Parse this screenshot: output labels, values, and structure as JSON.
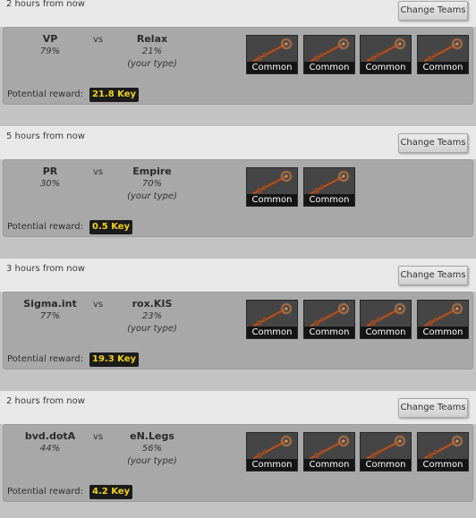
{
  "change_teams_label": "Change Teams",
  "potential_reward_label": "Potential reward:",
  "vs_label": "vs",
  "your_type_label": "(your type)",
  "item_icon": "key-icon",
  "colors": {
    "reward_text": "#f2d21a",
    "header_bg": "#e8e8e8",
    "body_bg": "#a8a8a8"
  },
  "matches": [
    {
      "time": "2 hours from now",
      "team_a": {
        "name": "VP",
        "pct": "79%"
      },
      "team_b": {
        "name": "Relax",
        "pct": "21%"
      },
      "items": [
        "Common",
        "Common",
        "Common",
        "Common"
      ],
      "reward": "21.8 Key"
    },
    {
      "time": "5 hours from now",
      "team_a": {
        "name": "PR",
        "pct": "30%"
      },
      "team_b": {
        "name": "Empire",
        "pct": "70%"
      },
      "items": [
        "Common",
        "Common"
      ],
      "reward": "0.5 Key"
    },
    {
      "time": "3 hours from now",
      "team_a": {
        "name": "Sigma.int",
        "pct": "77%"
      },
      "team_b": {
        "name": "rox.KIS",
        "pct": "23%"
      },
      "items": [
        "Common",
        "Common",
        "Common",
        "Common"
      ],
      "reward": "19.3 Key"
    },
    {
      "time": "2 hours from now",
      "team_a": {
        "name": "bvd.dotA",
        "pct": "44%"
      },
      "team_b": {
        "name": "eN.Legs",
        "pct": "56%"
      },
      "items": [
        "Common",
        "Common",
        "Common",
        "Common"
      ],
      "reward": "4.2 Key"
    }
  ]
}
